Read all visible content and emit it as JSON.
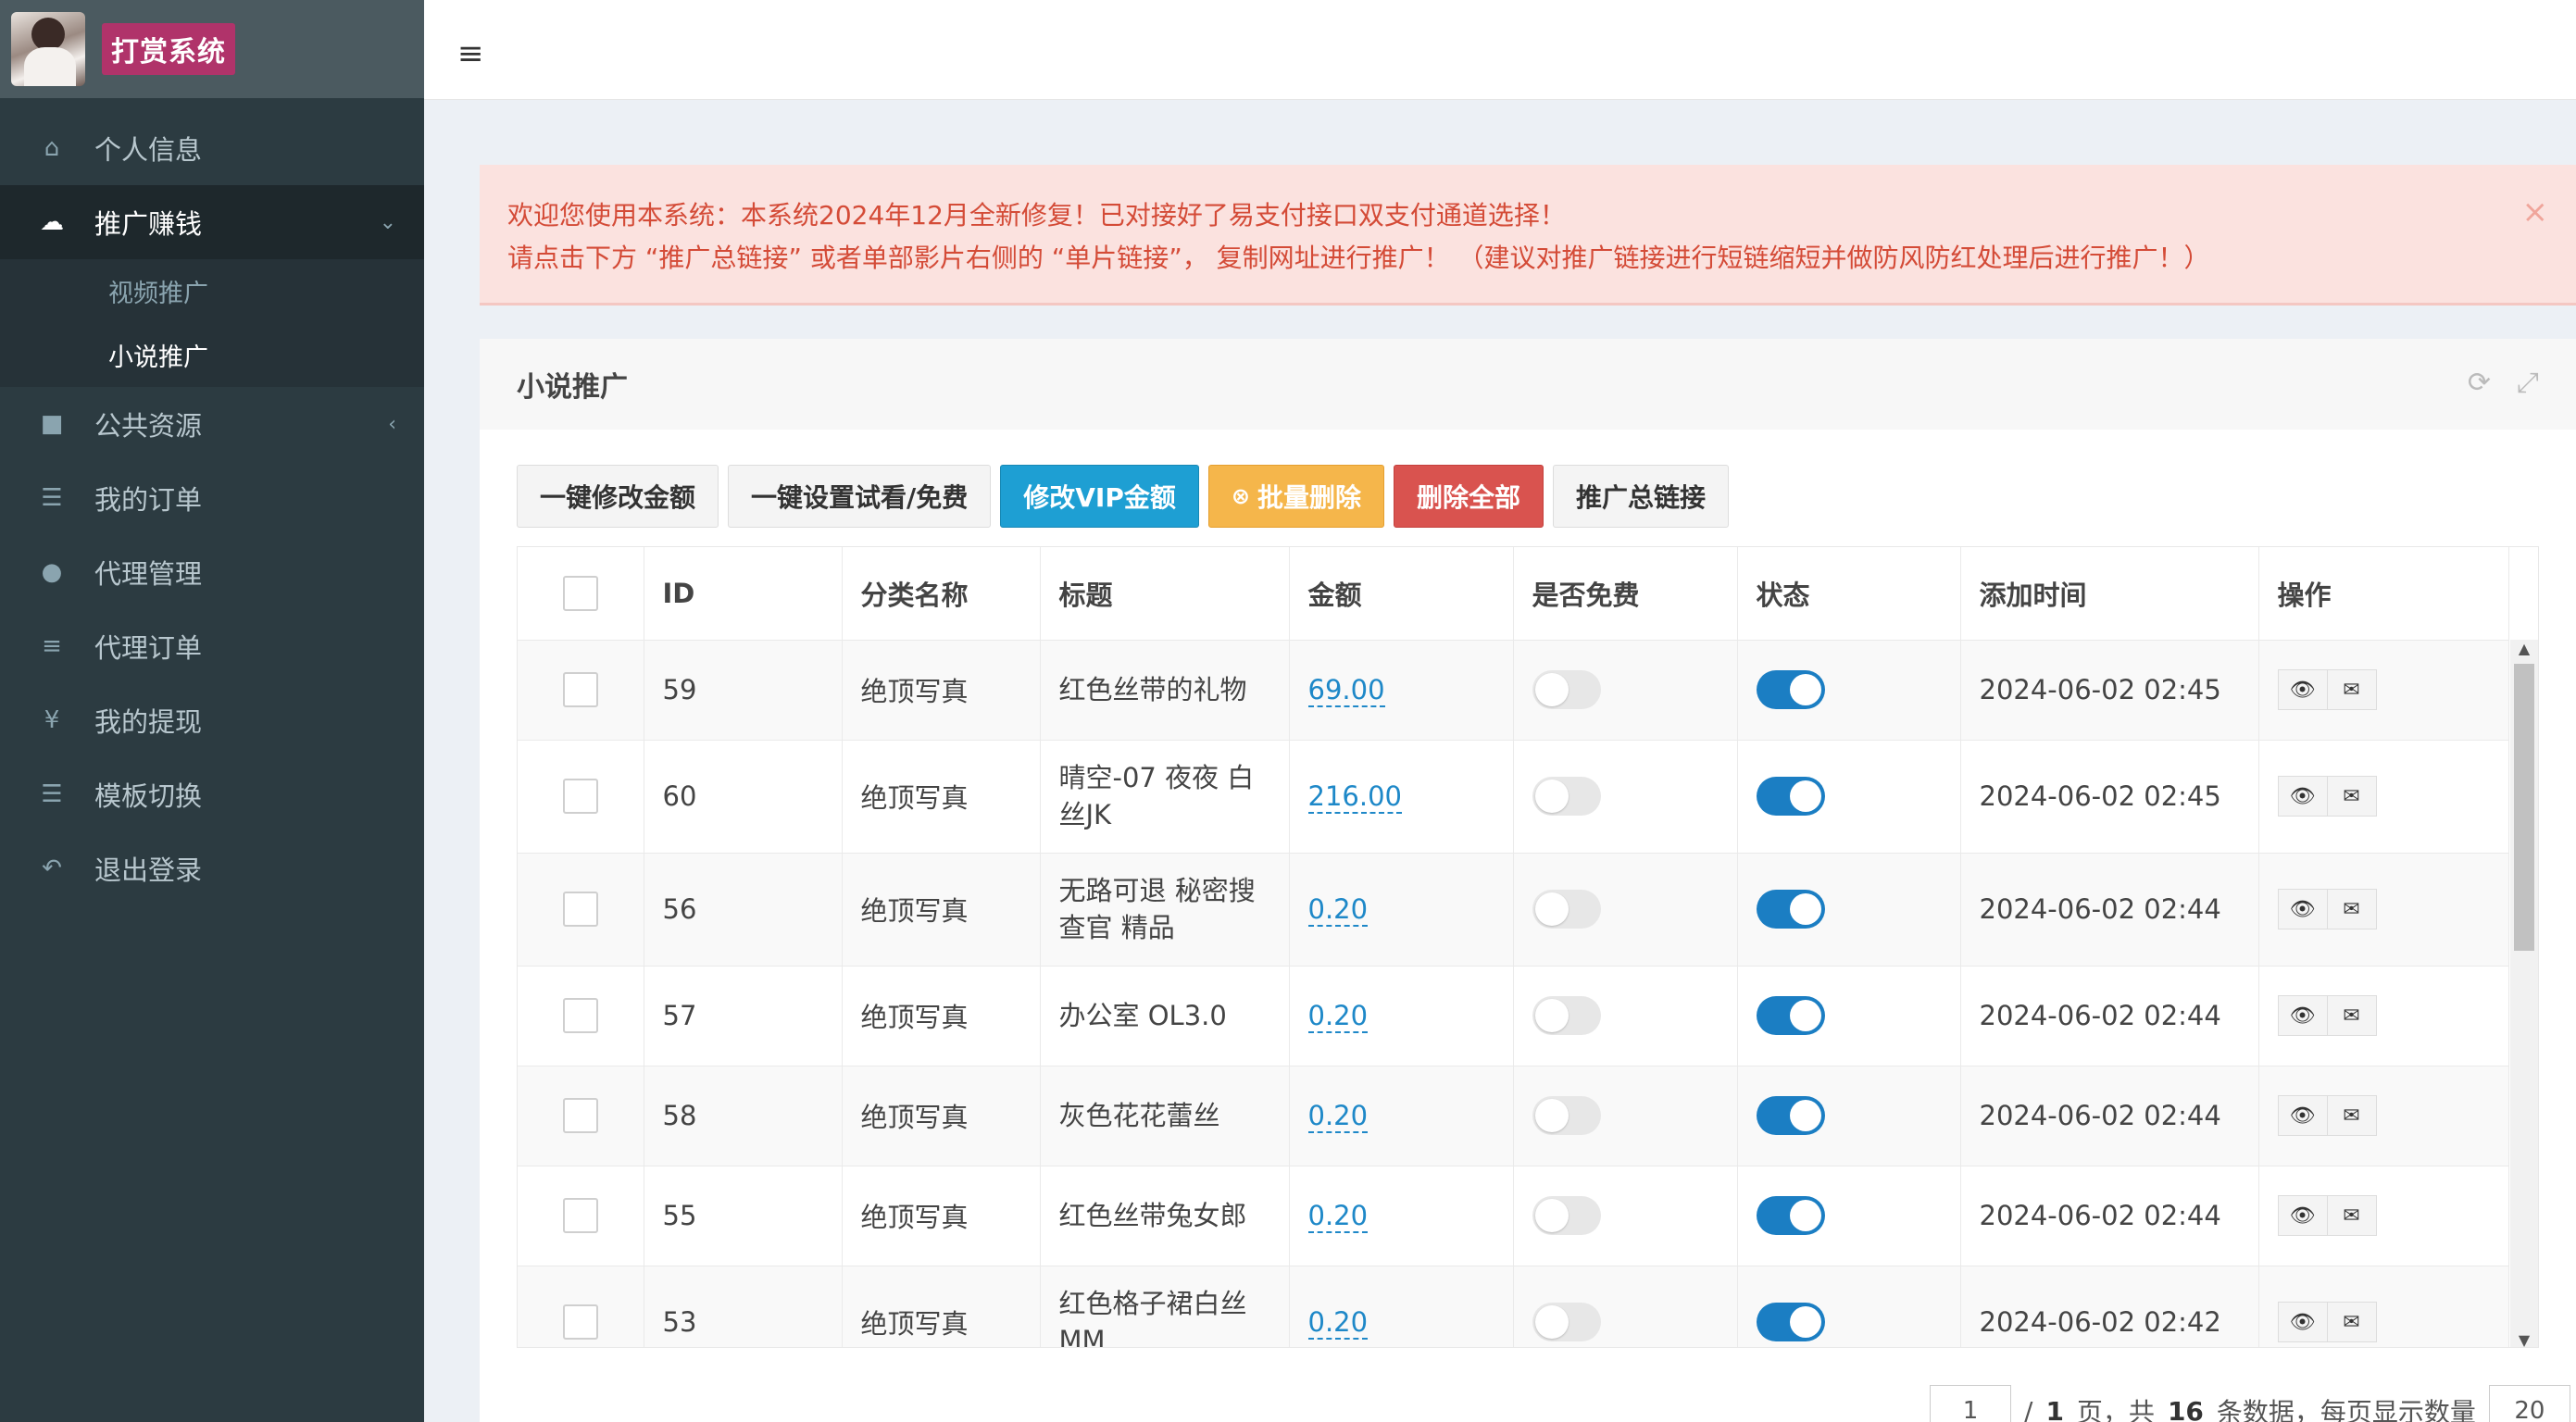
{
  "brand": {
    "title": "打赏系统"
  },
  "sidebar": {
    "items": [
      {
        "label": "个人信息",
        "icon": "home-icon"
      },
      {
        "label": "推广赚钱",
        "icon": "cloud-icon",
        "active": true,
        "expanded": true,
        "children": [
          {
            "label": "视频推广"
          },
          {
            "label": "小说推广",
            "current": true
          }
        ]
      },
      {
        "label": "公共资源",
        "icon": "video-icon"
      },
      {
        "label": "我的订单",
        "icon": "list-icon"
      },
      {
        "label": "代理管理",
        "icon": "users-icon"
      },
      {
        "label": "代理订单",
        "icon": "menu-icon"
      },
      {
        "label": "我的提现",
        "icon": "yen-icon"
      },
      {
        "label": "模板切换",
        "icon": "list-icon"
      },
      {
        "label": "退出登录",
        "icon": "reply-icon"
      }
    ]
  },
  "alert": {
    "line1": "欢迎您使用本系统：本系统2024年12月全新修复！已对接好了易支付接口双支付通道选择！",
    "line2": "请点击下方 “推广总链接” 或者单部影片右侧的 “单片链接”， 复制网址进行推广！ （建议对推广链接进行短链缩短并做防风防红处理后进行推广！）",
    "close": "×"
  },
  "panel": {
    "title": "小说推广"
  },
  "toolbar": {
    "btn1": "一键修改金额",
    "btn2": "一键设置试看/免费",
    "btn3": "修改VIP金额",
    "btn4": "批量删除",
    "btn5": "删除全部",
    "btn6": "推广总链接"
  },
  "table": {
    "headers": [
      "ID",
      "分类名称",
      "标题",
      "金额",
      "是否免费",
      "状态",
      "添加时间",
      "操作"
    ],
    "rows": [
      {
        "id": "59",
        "category": "绝顶写真",
        "title": "红色丝带的礼物",
        "price": "69.00",
        "free": false,
        "status": true,
        "time": "2024-06-02 02:45"
      },
      {
        "id": "60",
        "category": "绝顶写真",
        "title": "晴空-07 夜夜 白丝JK",
        "price": "216.00",
        "free": false,
        "status": true,
        "time": "2024-06-02 02:45"
      },
      {
        "id": "56",
        "category": "绝顶写真",
        "title": "无路可退 秘密搜查官 精品",
        "price": "0.20",
        "free": false,
        "status": true,
        "time": "2024-06-02 02:44"
      },
      {
        "id": "57",
        "category": "绝顶写真",
        "title": "办公室 OL3.0",
        "price": "0.20",
        "free": false,
        "status": true,
        "time": "2024-06-02 02:44"
      },
      {
        "id": "58",
        "category": "绝顶写真",
        "title": "灰色花花蕾丝",
        "price": "0.20",
        "free": false,
        "status": true,
        "time": "2024-06-02 02:44"
      },
      {
        "id": "55",
        "category": "绝顶写真",
        "title": "红色丝带兔女郎",
        "price": "0.20",
        "free": false,
        "status": true,
        "time": "2024-06-02 02:44"
      },
      {
        "id": "53",
        "category": "绝顶写真",
        "title": "红色格子裙白丝MM",
        "price": "0.20",
        "free": false,
        "status": true,
        "time": "2024-06-02 02:42"
      }
    ]
  },
  "pager": {
    "current": "1",
    "text1": "/",
    "total_pages": "1",
    "text2": "页，共",
    "total_items": "16",
    "text3": "条数据，每页显示数量",
    "per_page": "20"
  }
}
